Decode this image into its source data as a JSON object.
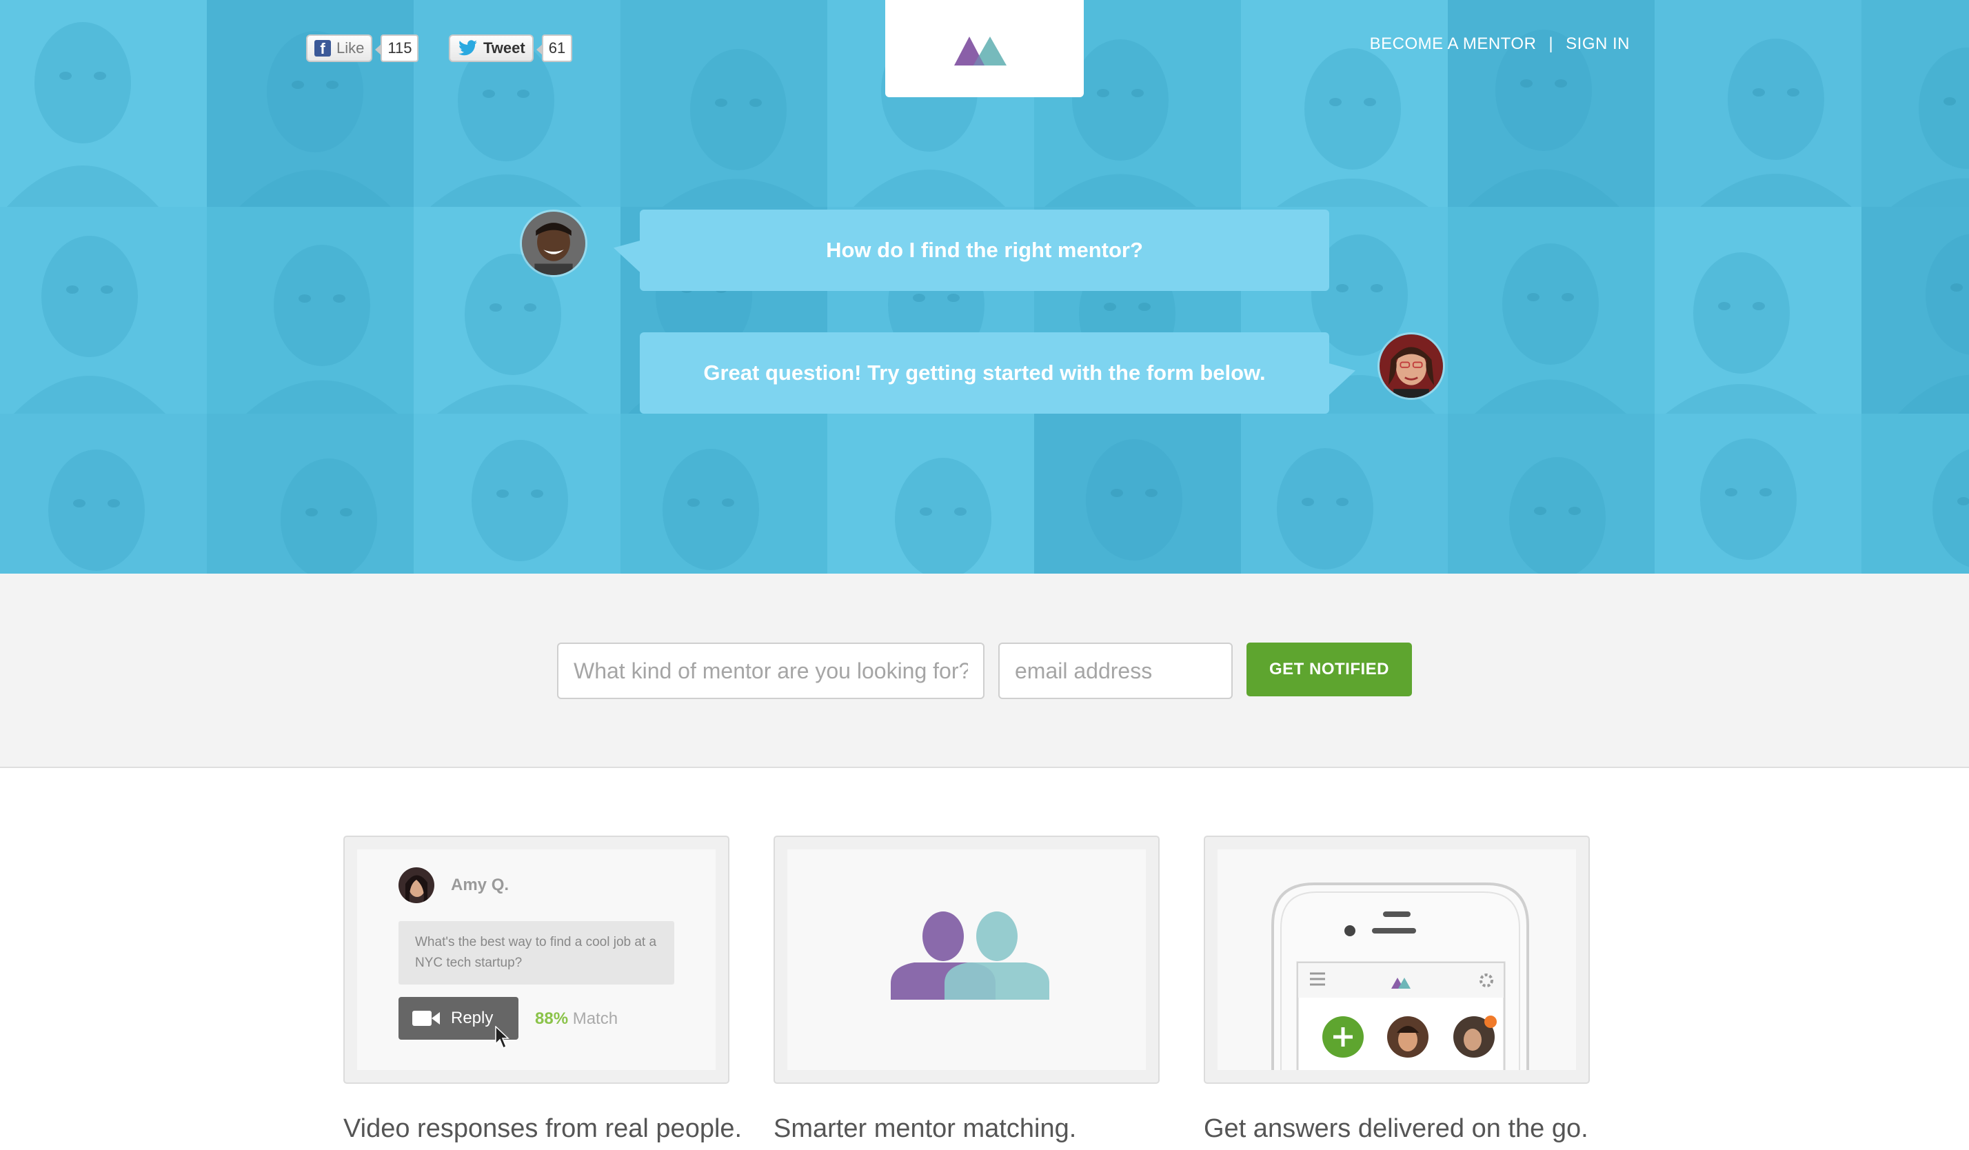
{
  "social": {
    "facebook": {
      "label": "Like",
      "count": "115"
    },
    "twitter": {
      "label": "Tweet",
      "count": "61"
    }
  },
  "nav": {
    "become_mentor": "BECOME A MENTOR",
    "separator": "|",
    "sign_in": "SIGN IN"
  },
  "hero": {
    "question": "How do I find the right mentor?",
    "answer": "Great question! Try getting started with the form below."
  },
  "form": {
    "mentor_placeholder": "What kind of mentor are you looking for?",
    "email_placeholder": "email address",
    "submit_label": "GET NOTIFIED"
  },
  "features": [
    {
      "caption": "Video responses from real people.",
      "user_name": "Amy Q.",
      "message": "What's the best way to find a cool job at a NYC tech startup?",
      "reply_label": "Reply",
      "match_percent": "88%",
      "match_label": "Match"
    },
    {
      "caption": "Smarter mentor matching."
    },
    {
      "caption": "Get answers delivered on the go."
    }
  ],
  "colors": {
    "hero_blue": "#55c0e0",
    "bubble_blue": "#7ed4f0",
    "cta_green": "#5ea52f",
    "logo_purple": "#8a5fa8",
    "logo_teal": "#6fb6b8"
  }
}
